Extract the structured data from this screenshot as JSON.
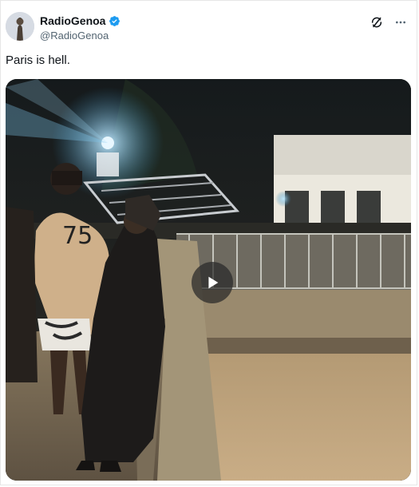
{
  "tweet": {
    "author": {
      "display_name": "RadioGenoa",
      "handle": "@RadioGenoa",
      "verified": true,
      "avatar_icon": "statue-avatar"
    },
    "text": "Paris is hell.",
    "actions": {
      "grok_icon": "grok-icon",
      "more_icon": "more-dots-icon"
    },
    "media": {
      "type": "video",
      "play_icon": "play-icon",
      "jersey_number": "75"
    }
  },
  "colors": {
    "verified_blue": "#1d9bf0",
    "text_primary": "#0f1419",
    "text_secondary": "#536471"
  }
}
